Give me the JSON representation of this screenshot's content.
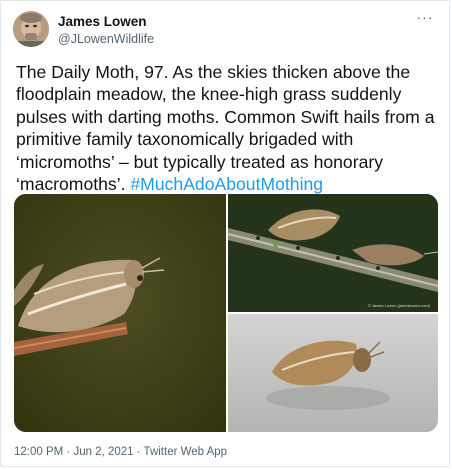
{
  "author": {
    "name": "James Lowen",
    "handle": "@JLowenWildlife",
    "avatar_icon": "avatar-photo"
  },
  "menu": {
    "icon": "more-dots-icon",
    "glyph": "···"
  },
  "tweet": {
    "text": "The Daily Moth, 97. As the skies thicken above the floodplain meadow, the knee-high grass suddenly pulses with darting moths. Common Swift hails from a primitive family taxonomically brigaded with ‘micromoths’ – but typically treated as honorary ‘macromoths’. ",
    "hashtag": "#MuchAdoAboutMothing"
  },
  "media": {
    "photo_credit": "© James Lowen (jameslowen.com)",
    "colors": {
      "photo1_bg": "#4a4a1e",
      "photo2_bg": "#23341a",
      "photo3_bg": "#c7c7c5"
    }
  },
  "meta": {
    "timestamp": "12:00 PM · Jun 2, 2021 · Twitter Web App"
  },
  "colors": {
    "link": "#1d9bf0",
    "secondary_text": "#536471",
    "border": "#e1e8ed"
  }
}
